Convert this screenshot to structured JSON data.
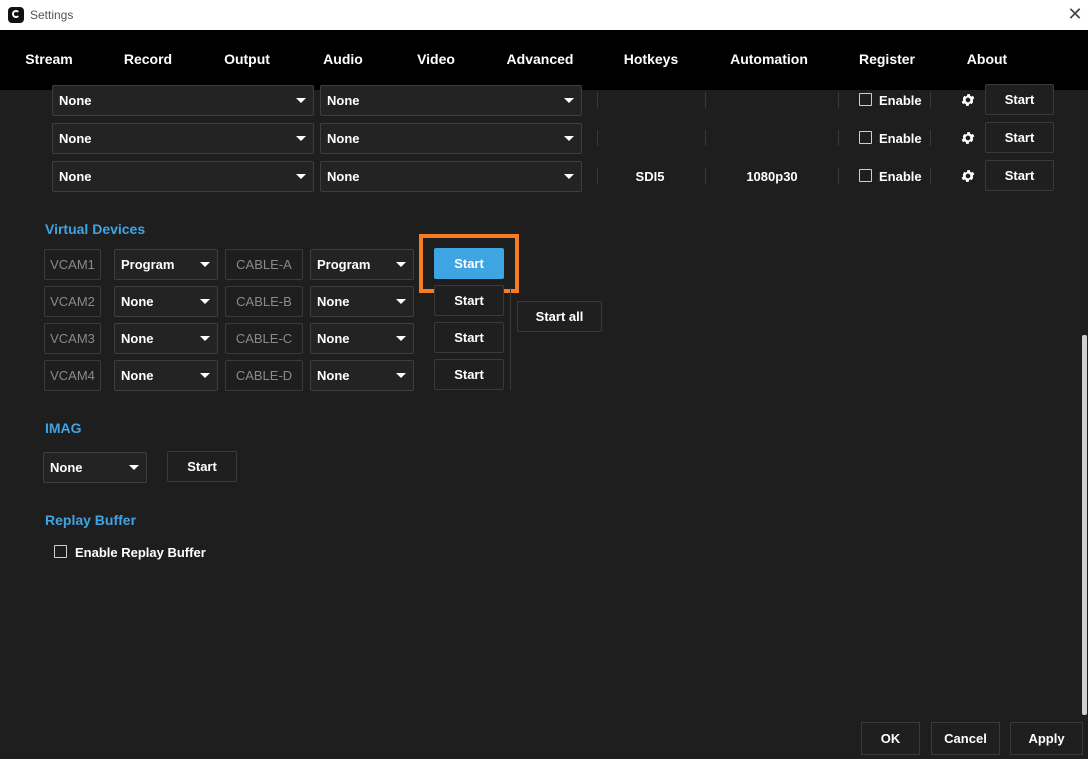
{
  "window": {
    "title": "Settings"
  },
  "tabs": [
    {
      "label": "Stream"
    },
    {
      "label": "Record"
    },
    {
      "label": "Output"
    },
    {
      "label": "Audio"
    },
    {
      "label": "Video"
    },
    {
      "label": "Advanced"
    },
    {
      "label": "Hotkeys"
    },
    {
      "label": "Automation"
    },
    {
      "label": "Register"
    },
    {
      "label": "About"
    }
  ],
  "active_tab": "Output",
  "output_rows": [
    {
      "source1": "None",
      "source2": "None",
      "device": "",
      "format": "",
      "enable_label": "Enable",
      "start_label": "Start"
    },
    {
      "source1": "None",
      "source2": "None",
      "device": "",
      "format": "",
      "enable_label": "Enable",
      "start_label": "Start"
    },
    {
      "source1": "None",
      "source2": "None",
      "device": "SDI5",
      "format": "1080p30",
      "enable_label": "Enable",
      "start_label": "Start"
    }
  ],
  "virtual_devices": {
    "title": "Virtual Devices",
    "rows": [
      {
        "vcam": "VCAM1",
        "video_source": "Program",
        "cable": "CABLE-A",
        "audio_source": "Program",
        "start_label": "Start"
      },
      {
        "vcam": "VCAM2",
        "video_source": "None",
        "cable": "CABLE-B",
        "audio_source": "None",
        "start_label": "Start"
      },
      {
        "vcam": "VCAM3",
        "video_source": "None",
        "cable": "CABLE-C",
        "audio_source": "None",
        "start_label": "Start"
      },
      {
        "vcam": "VCAM4",
        "video_source": "None",
        "cable": "CABLE-D",
        "audio_source": "None",
        "start_label": "Start"
      }
    ],
    "start_all_label": "Start all"
  },
  "imag": {
    "title": "IMAG",
    "source": "None",
    "start_label": "Start"
  },
  "replay_buffer": {
    "title": "Replay Buffer",
    "enable_label": "Enable Replay Buffer"
  },
  "footer": {
    "ok": "OK",
    "cancel": "Cancel",
    "apply": "Apply"
  },
  "colors": {
    "accent": "#3fa4e2",
    "highlight": "#f57c22",
    "background": "#1e1e1e",
    "tabbar": "#000000"
  },
  "icons": {
    "settings": "gear-icon",
    "close": "close-icon",
    "dropdown": "chevron-down-icon"
  }
}
